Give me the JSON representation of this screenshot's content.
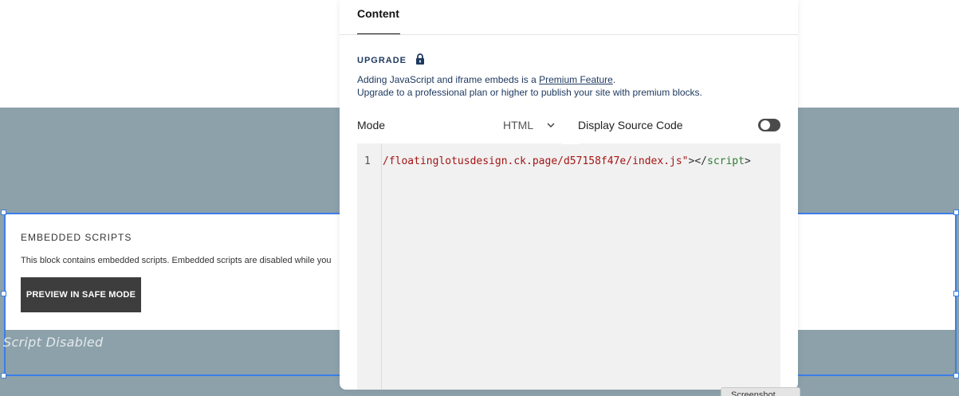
{
  "panel": {
    "tab": "Content",
    "upgrade": {
      "label": "UPGRADE",
      "line1_before": "Adding JavaScript and iframe embeds is a ",
      "line1_link": "Premium Feature",
      "line1_after": ".",
      "line2": "Upgrade to a professional plan or higher to publish your site with premium blocks."
    },
    "mode": {
      "label": "Mode",
      "value": "HTML"
    },
    "display_source": {
      "label": "Display Source Code",
      "enabled": false
    },
    "editor": {
      "line_number": "1",
      "code_string": "/floatinglotusdesign.ck.page/d57158f47e/index.js\"",
      "code_close_open": "></",
      "code_tag": "script",
      "code_close": ">"
    }
  },
  "embed_block": {
    "title": "EMBEDDED SCRIPTS",
    "description": "This block contains embedded scripts. Embedded scripts are disabled while you",
    "button": "PREVIEW IN SAFE MODE",
    "placeholder": "Script Disabled"
  },
  "screenshot_tag": "Screenshot",
  "colors": {
    "band": "#8ca1aa",
    "selection": "#3b7ee8",
    "navy_text": "#1f3a60",
    "code_string": "#a31515",
    "code_tag": "#2f7d32"
  }
}
